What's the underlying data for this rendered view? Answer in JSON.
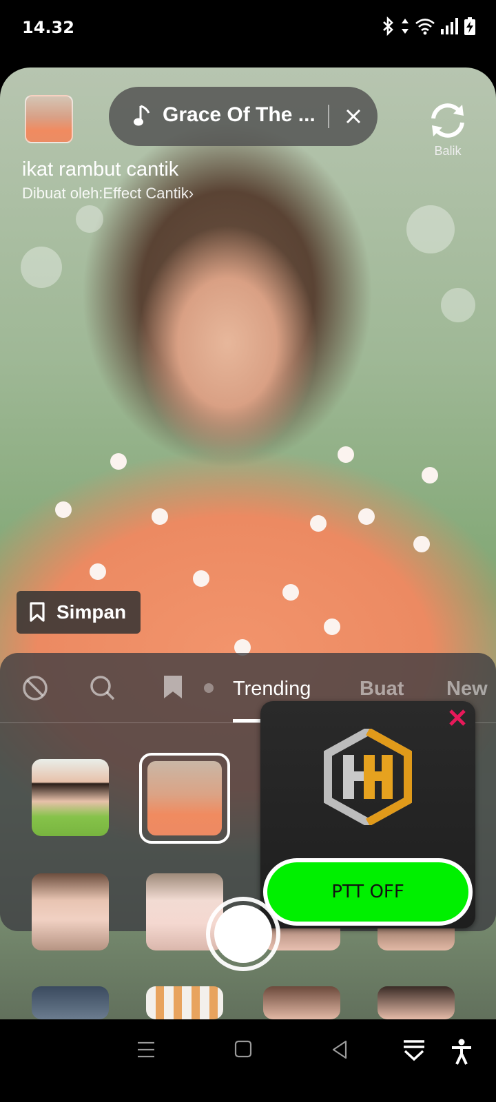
{
  "status_bar": {
    "time": "14.32",
    "icons": [
      "bluetooth-icon",
      "data-arrows-icon",
      "wifi-icon",
      "signal-icon",
      "battery-charging-icon"
    ]
  },
  "camera": {
    "music": {
      "title": "Grace Of The ...",
      "icon": "music-note-icon",
      "close_icon": "close-icon"
    },
    "flip": {
      "label": "Balik",
      "icon": "flip-camera-icon"
    },
    "effect": {
      "name": "ikat rambut cantik",
      "author_prefix": "Dibuat oleh: ",
      "author": "Effect Cantik",
      "chevron": "›"
    },
    "save": {
      "label": "Simpan",
      "icon": "bookmark-icon"
    }
  },
  "effects_panel": {
    "tabs": [
      {
        "icon": "no-effect-icon"
      },
      {
        "icon": "search-icon"
      },
      {
        "icon": "bookmark-icon"
      },
      {
        "label": "Trending",
        "active": true
      },
      {
        "label": "Buat",
        "active": false
      },
      {
        "label": "New",
        "active": false
      }
    ]
  },
  "ptt_widget": {
    "logo": "HH",
    "button_label": "PTT OFF",
    "close_icon": "close-x-icon",
    "button_color": "#00f000",
    "close_color": "#e8195a"
  },
  "nav": {
    "icons": [
      "menu-icon",
      "home-square-icon",
      "back-triangle-icon",
      "download-collapse-icon",
      "accessibility-icon"
    ]
  }
}
